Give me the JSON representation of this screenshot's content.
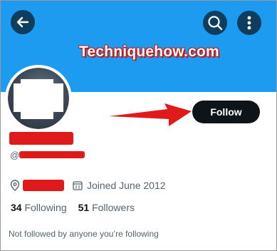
{
  "header": {
    "back_icon": "arrow-left-icon",
    "search_icon": "search-icon",
    "more_icon": "more-vertical-icon",
    "watermark": "Techniquehow.com"
  },
  "profile": {
    "follow_label": "Follow",
    "handle_prefix": "@",
    "joined_label": "Joined June 2012",
    "following_count": "34",
    "following_label": "Following",
    "followers_count": "51",
    "followers_label": "Followers",
    "followed_by_note": "Not followed by anyone you’re following"
  },
  "colors": {
    "banner": "#1d9bf0",
    "follow_button": "#0f1419",
    "redaction": "#e01a1a"
  }
}
